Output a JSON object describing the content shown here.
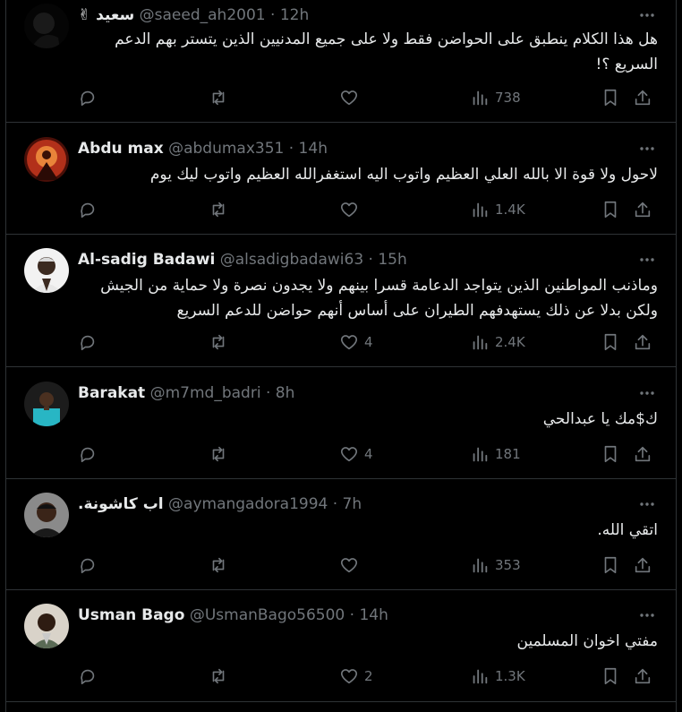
{
  "tweets": [
    {
      "name": "سعيد ✌",
      "handle": "@saeed_ah2001",
      "time": "· 12h",
      "text": "هل هذا الكلام ينطبق على الحواضن فقط ولا على جميع المدنيين الذين يتستر بهم الدعم السريع ؟!",
      "likes": "",
      "views": "738"
    },
    {
      "name": "Abdu max",
      "handle": "@abdumax351",
      "time": "· 14h",
      "text": "لاحول ولا قوة الا بالله العلي العظيم واتوب اليه استغفرالله العظيم واتوب ليك يوم",
      "likes": "",
      "views": "1.4K"
    },
    {
      "name": "Al-sadig Badawi",
      "handle": "@alsadigbadawi63",
      "time": "· 15h",
      "text": "وماذنب المواطنين الذين يتواجد الدعامة قسرا بينهم ولا يجدون نصرة ولا حماية من الجيش ولكن بدلا عن ذلك يستهدفهم الطيران على أساس أنهم حواضن للدعم السريع",
      "likes": "4",
      "views": "2.4K"
    },
    {
      "name": "Barakat",
      "handle": "@m7md_badri",
      "time": "· 8h",
      "text": "ك$مك يا عبدالحي",
      "likes": "4",
      "views": "181"
    },
    {
      "name": "اب كاشونة.",
      "handle": "@aymangadora1994",
      "time": "· 7h",
      "text": "اتقي الله.",
      "likes": "",
      "views": "353"
    },
    {
      "name": "Usman Bago",
      "handle": "@UsmanBago56500",
      "time": "· 14h",
      "text": "مفتي اخوان المسلمين",
      "likes": "2",
      "views": "1.3K"
    }
  ],
  "colors": {
    "background": "#000000",
    "text": "#e7e9ea",
    "secondary": "#71767b",
    "divider": "#2f3336"
  },
  "icons": [
    "reply-icon",
    "retweet-icon",
    "like-icon",
    "views-icon",
    "bookmark-icon",
    "share-icon",
    "more-icon"
  ]
}
